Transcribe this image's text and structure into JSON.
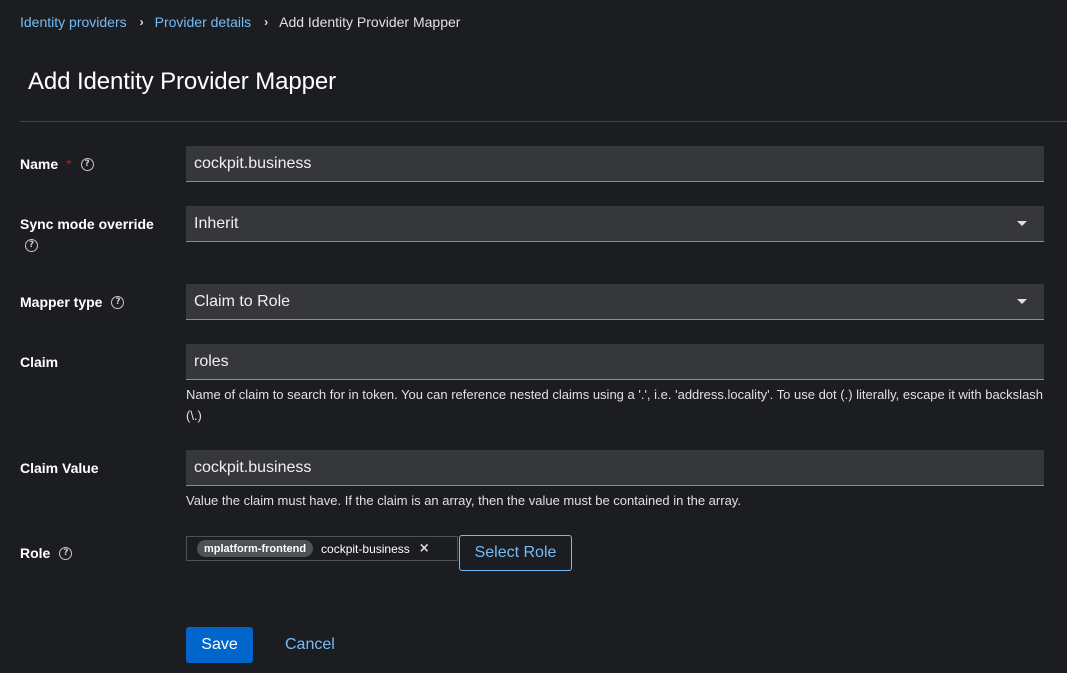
{
  "breadcrumb": {
    "items": [
      "Identity providers",
      "Provider details"
    ],
    "current": "Add Identity Provider Mapper",
    "separator": "›"
  },
  "page": {
    "title": "Add Identity Provider Mapper"
  },
  "form": {
    "name": {
      "label": "Name",
      "required_mark": "*",
      "value": "cockpit.business"
    },
    "sync_mode": {
      "label": "Sync mode override",
      "value": "Inherit"
    },
    "mapper_type": {
      "label": "Mapper type",
      "value": "Claim to Role"
    },
    "claim": {
      "label": "Claim",
      "value": "roles",
      "helper": "Name of claim to search for in token. You can reference nested claims using a '.', i.e. 'address.locality'. To use dot (.) literally, escape it with backslash (\\.)"
    },
    "claim_value": {
      "label": "Claim Value",
      "value": "cockpit.business",
      "helper": "Value the claim must have. If the claim is an array, then the value must be contained in the array."
    },
    "role": {
      "label": "Role",
      "chip_client": "mplatform-frontend",
      "chip_role": "cockpit-business",
      "chip_close": "×",
      "select_label": "Select Role"
    },
    "help_glyph": "?"
  },
  "actions": {
    "save_label": "Save",
    "cancel_label": "Cancel"
  },
  "colors": {
    "background": "#1b1d21",
    "link": "#73bcf7",
    "primary": "#0066cc",
    "required": "#c9190b",
    "input_bg": "#36373a"
  }
}
